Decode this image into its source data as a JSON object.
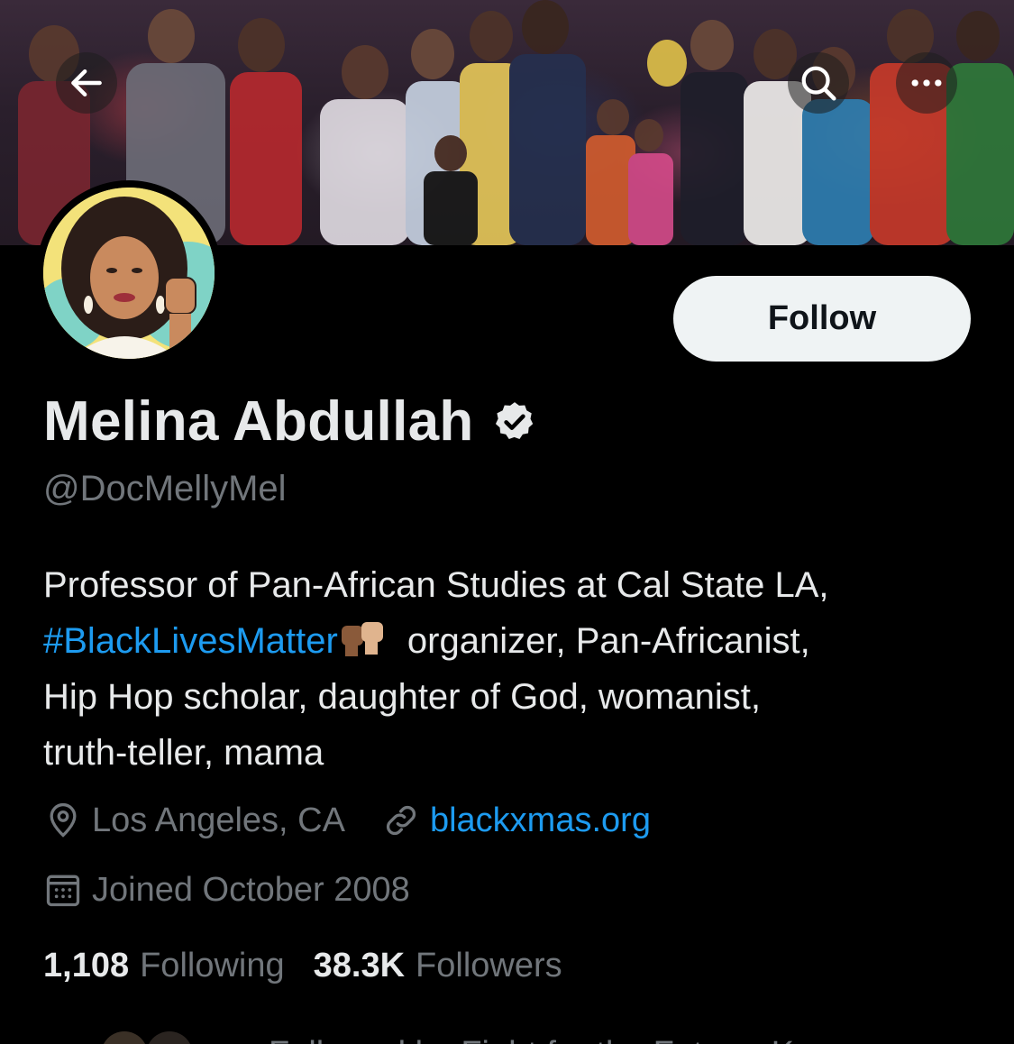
{
  "header": {
    "back_icon": "arrow-left-icon",
    "search_icon": "search-icon",
    "more_icon": "more-horizontal-icon"
  },
  "profile": {
    "display_name": "Melina Abdullah",
    "verified": true,
    "handle": "@DocMellyMel",
    "follow_label": "Follow",
    "bio": {
      "line1": "Professor of Pan-African Studies at Cal State LA,",
      "hashtag": "#BlackLivesMatter",
      "emoji": "✊🏾✊🏼",
      "line2_rest": " organizer, Pan-Africanist,",
      "line3": "Hip Hop scholar, daughter of God, womanist,",
      "line4": "truth-teller, mama"
    },
    "location": "Los Angeles, CA",
    "website": "blackxmas.org",
    "joined": "Joined October 2008",
    "following_count": "1,108",
    "following_label": "Following",
    "followers_count": "38.3K",
    "followers_label": "Followers",
    "followed_by_partial": "Followed by Fight for the Future, K..."
  },
  "colors": {
    "background": "#000000",
    "text_primary": "#e7e9ea",
    "text_secondary": "#71767b",
    "link": "#1d9bf0",
    "follow_button_bg": "#eff3f4"
  }
}
